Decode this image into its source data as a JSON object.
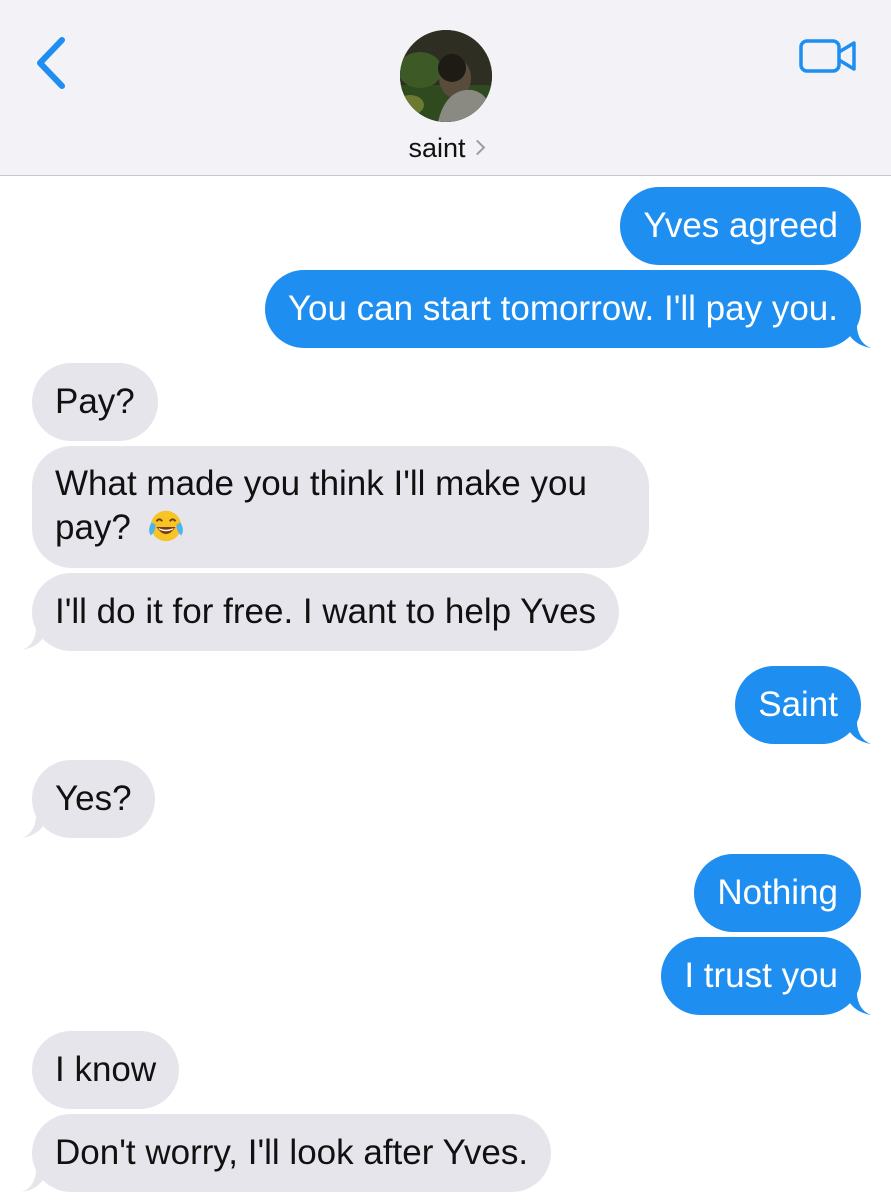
{
  "header": {
    "contact_name": "saint",
    "back_icon": "chevron-left-icon",
    "video_icon": "video-camera-icon",
    "accent_color": "#1e8ef0"
  },
  "messages": [
    {
      "from": "me",
      "text": "Yves agreed"
    },
    {
      "from": "me",
      "text": "You can start tomorrow. I'll pay you."
    },
    {
      "from": "them",
      "text": "Pay?"
    },
    {
      "from": "them",
      "text": "What made you think I'll make you pay?",
      "emoji": "face-with-tears-of-joy"
    },
    {
      "from": "them",
      "text": "I'll do it for free. I want to help Yves"
    },
    {
      "from": "me",
      "text": "Saint"
    },
    {
      "from": "them",
      "text": "Yes?"
    },
    {
      "from": "me",
      "text": "Nothing"
    },
    {
      "from": "me",
      "text": "I trust you"
    },
    {
      "from": "them",
      "text": "I know"
    },
    {
      "from": "them",
      "text": "Don't worry, I'll look after Yves."
    }
  ],
  "colors": {
    "sent_bubble": "#1e8ef0",
    "received_bubble": "#e6e5eb",
    "header_bg": "#f2f2f7"
  }
}
